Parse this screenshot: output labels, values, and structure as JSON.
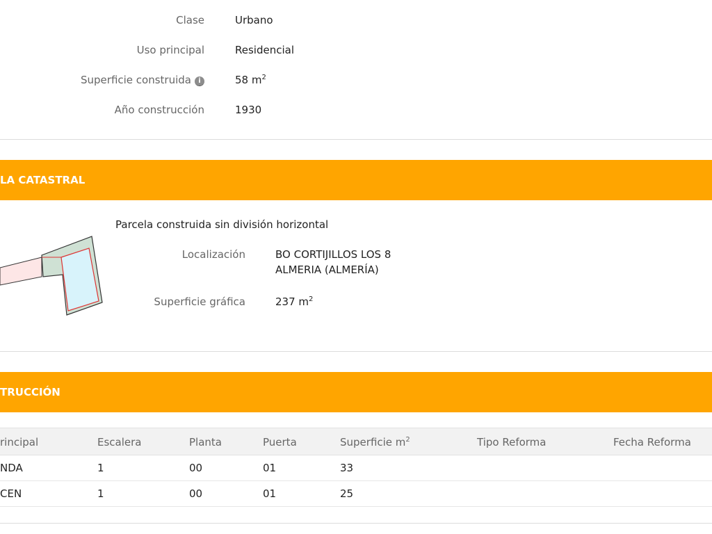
{
  "property": {
    "clase_label": "Clase",
    "clase_value": "Urbano",
    "uso_label": "Uso principal",
    "uso_value": "Residencial",
    "superficie_label": "Superficie construida",
    "superficie_value": "58 m",
    "superficie_unit_sup": "2",
    "info_icon": "info-icon",
    "anio_label": "Año construcción",
    "anio_value": "1930"
  },
  "parcel_section": {
    "title": "LA CATASTRAL",
    "subtitle": "Parcela construida sin división horizontal",
    "localizacion_label": "Localización",
    "localizacion_line1": "BO CORTIJILLOS LOS 8",
    "localizacion_line2": "ALMERIA (ALMERÍA)",
    "superficie_label": "Superficie gráfica",
    "superficie_value": "237 m",
    "superficie_unit_sup": "2"
  },
  "construction_section": {
    "title": "TRUCCIÓN"
  },
  "table": {
    "headers": {
      "uso": "rincipal",
      "escalera": "Escalera",
      "planta": "Planta",
      "puerta": "Puerta",
      "superficie": "Superficie m",
      "superficie_sup": "2",
      "tipo_reforma": "Tipo Reforma",
      "fecha_reforma": "Fecha Reforma"
    },
    "rows": [
      {
        "uso": "NDA",
        "escalera": "1",
        "planta": "00",
        "puerta": "01",
        "superficie": "33",
        "tipo_reforma": "",
        "fecha_reforma": ""
      },
      {
        "uso": "CEN",
        "escalera": "1",
        "planta": "00",
        "puerta": "01",
        "superficie": "25",
        "tipo_reforma": "",
        "fecha_reforma": ""
      }
    ]
  },
  "colors": {
    "accent": "#ffa500",
    "label": "#666666",
    "text": "#222222"
  }
}
